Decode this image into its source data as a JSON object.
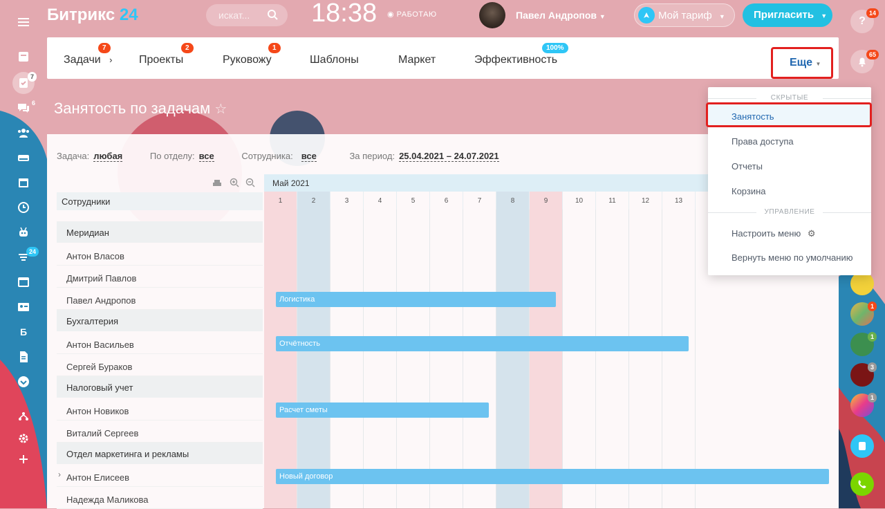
{
  "header": {
    "logo_main": "Битрикс",
    "logo_num": "24",
    "search_placeholder": "искат...",
    "clock": "18:38",
    "work_status": "РАБОТАЮ",
    "user_name": "Павел Андропов",
    "tariff_label": "Мой тариф",
    "invite_label": "Пригласить"
  },
  "left_sidebar": {
    "badges": {
      "tasks": "7",
      "chat": "6",
      "filter": "24"
    },
    "letter": "Б"
  },
  "right_sidebar": {
    "help_badge": "14",
    "notif_badge": "65",
    "avatar_badges": [
      "1",
      "1",
      "3",
      "1"
    ]
  },
  "nav": {
    "tabs": [
      {
        "label": "Задачи",
        "badge": "7"
      },
      {
        "label": "Проекты",
        "badge": "2"
      },
      {
        "label": "Руковожу",
        "badge": "1"
      },
      {
        "label": "Шаблоны",
        "badge": ""
      },
      {
        "label": "Маркет",
        "badge": ""
      },
      {
        "label": "Эффективность",
        "badge": "100%"
      }
    ],
    "more_label": "Еще"
  },
  "page_title": "Занятость по задачам",
  "filters": {
    "task_label": "Задача:",
    "task_value": "любая",
    "dept_label": "По отделу:",
    "dept_value": "все",
    "emp_label": "Сотрудника:",
    "emp_value": "все",
    "period_label": "За период:",
    "period_value": "25.04.2021 – 24.07.2021"
  },
  "employees": {
    "header": "Сотрудники",
    "rows": [
      {
        "type": "group",
        "label": "Меридиан"
      },
      {
        "type": "emp",
        "label": "Антон Власов"
      },
      {
        "type": "emp",
        "label": "Дмитрий Павлов"
      },
      {
        "type": "emp",
        "label": "Павел Андропов"
      },
      {
        "type": "group",
        "label": "Бухгалтерия"
      },
      {
        "type": "emp",
        "label": "Антон Васильев"
      },
      {
        "type": "emp",
        "label": "Сергей Бураков"
      },
      {
        "type": "group",
        "label": "Налоговый учет"
      },
      {
        "type": "emp",
        "label": "Антон Новиков"
      },
      {
        "type": "emp",
        "label": "Виталий Сергеев"
      },
      {
        "type": "group",
        "label": "Отдел маркетинга и рекламы"
      },
      {
        "type": "emp",
        "label": "Антон Елисеев"
      },
      {
        "type": "emp",
        "label": "Надежда Маликова"
      }
    ]
  },
  "gantt": {
    "month": "Май 2021",
    "days": [
      "1",
      "2",
      "3",
      "4",
      "5",
      "6",
      "7",
      "8",
      "9",
      "10",
      "11",
      "12",
      "13"
    ],
    "bars": [
      {
        "label": "Логистика"
      },
      {
        "label": "Отчётность"
      },
      {
        "label": "Расчет сметы"
      },
      {
        "label": "Новый договор"
      }
    ]
  },
  "dropdown": {
    "hidden_section": "СКРЫТЫЕ",
    "hidden_items": [
      "Занятость",
      "Права доступа",
      "Отчеты",
      "Корзина"
    ],
    "manage_section": "УПРАВЛЕНИЕ",
    "manage_items": [
      "Настроить меню",
      "Вернуть меню по умолчанию"
    ]
  },
  "colors": {
    "accent": "#2fc6f6",
    "badge": "#f54819",
    "highlight_border": "#e2201f",
    "gantt_bar": "#6cc3f0"
  }
}
